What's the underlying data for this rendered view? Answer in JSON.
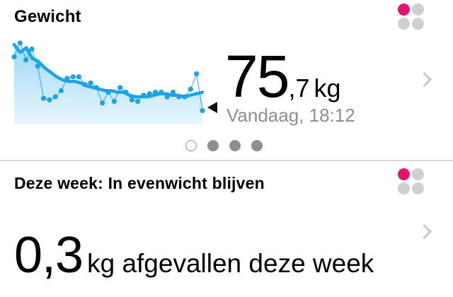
{
  "weight_card": {
    "title": "Gewicht",
    "value_int": "75",
    "value_dec": ",7",
    "unit": "kg",
    "timestamp": "Vandaag, 18:12",
    "page_dots": {
      "count": 4,
      "active_index": 0
    }
  },
  "week_card": {
    "title": "Deze week: In evenwicht blijven",
    "value": "0,3",
    "text": "kg afgevallen deze week"
  },
  "icons": {
    "app_logo": "flower-logo-icon",
    "chevron": "chevron-right-icon",
    "current_marker": "triangle-left-icon"
  },
  "colors": {
    "accent_blue": "#1aa3e6",
    "fill_blue_top": "#9fd9f7",
    "fill_blue_bottom": "#e7f6fd",
    "logo_pink": "#e5146e",
    "logo_grey": "#cfcfcf",
    "text_grey": "#8e8e93",
    "divider": "#d9d9d9"
  },
  "chart_data": {
    "type": "line",
    "series": [
      {
        "values": [
          78.4,
          77.9,
          78.2,
          77.5,
          77.3,
          76.9,
          76.6,
          76.3,
          76.1,
          76.0,
          76.0,
          75.9,
          75.7,
          75.6,
          75.5,
          75.4,
          75.4,
          75.3,
          75.3,
          75.1,
          75.0,
          75.0,
          75.0,
          75.1,
          75.2,
          75.2,
          75.1,
          75.1,
          75.0,
          75.1,
          75.2,
          75.3
        ]
      },
      {
        "values": [
          77.6,
          78.5,
          77.4,
          78.1,
          77.0,
          74.9,
          74.8,
          75.0,
          75.4,
          76.2,
          76.3,
          76.3,
          75.8,
          75.9,
          75.6,
          74.6,
          75.3,
          74.7,
          75.6,
          75.3,
          74.8,
          74.7,
          75.1,
          75.2,
          75.3,
          75.3,
          75.0,
          75.3,
          75.0,
          75.0,
          75.5,
          76.5,
          74.1
        ]
      }
    ],
    "ylim": [
      73.2,
      79.0
    ]
  }
}
